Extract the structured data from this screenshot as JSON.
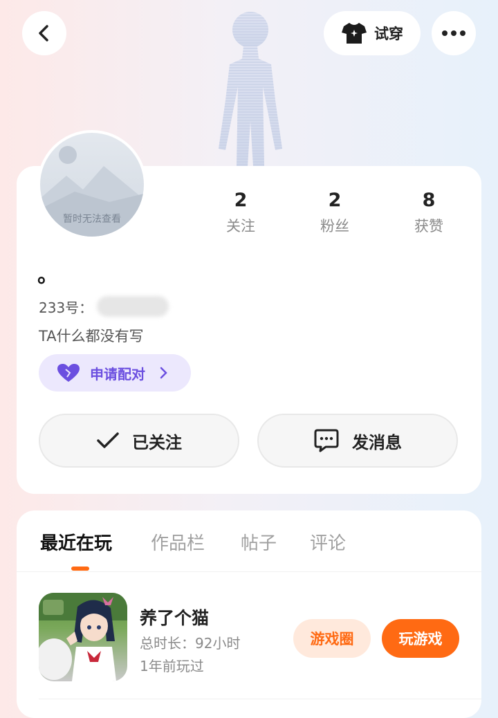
{
  "header": {
    "try_on_label": "试穿"
  },
  "profile": {
    "avatar_placeholder": "暂时无法查看",
    "name": "。",
    "id_label": "233号：",
    "bio": "TA什么都没有写",
    "pair_label": "申请配对",
    "stats": [
      {
        "value": "2",
        "label": "关注"
      },
      {
        "value": "2",
        "label": "粉丝"
      },
      {
        "value": "8",
        "label": "获赞"
      }
    ],
    "follow_label": "已关注",
    "message_label": "发消息"
  },
  "tabs": [
    "最近在玩",
    "作品栏",
    "帖子",
    "评论"
  ],
  "recent_game": {
    "title": "养了个猫",
    "duration": "总时长：92小时",
    "last_played": "1年前玩过",
    "circle_label": "游戏圈",
    "play_label": "玩游戏"
  },
  "colors": {
    "accent": "#ff6a13",
    "pair_bg": "#ece8fd",
    "pair_text": "#6b4fe0"
  }
}
